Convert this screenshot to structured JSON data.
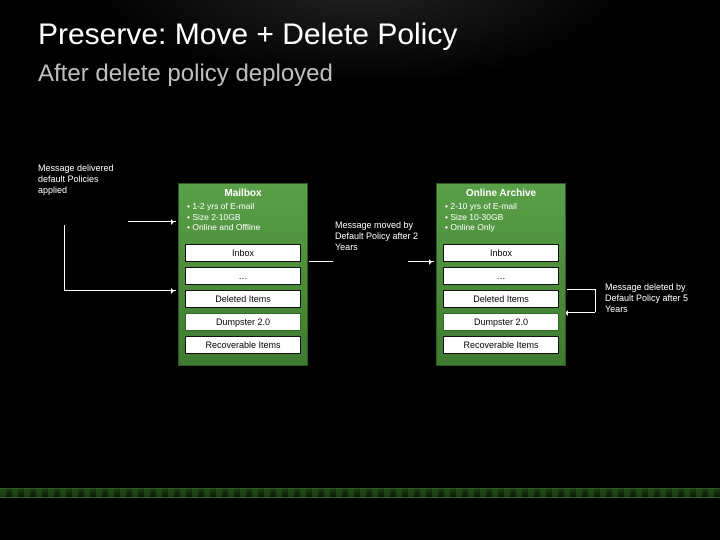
{
  "title": "Preserve: Move + Delete Policy",
  "subtitle": "After delete policy deployed",
  "annotLeft": "Message delivered default Policies applied",
  "annotMid": "Message moved by Default Policy after 2 Years",
  "annotRight": "Message deleted by Default Policy after 5 Years",
  "mailbox": {
    "title": "Mailbox",
    "bullets": "• 1-2 yrs of E-mail\n• Size 2-10GB\n• Online and Offline",
    "rows": [
      "Inbox",
      "…",
      "Deleted Items",
      "Dumpster 2.0",
      "Recoverable Items"
    ]
  },
  "archive": {
    "title": "Online Archive",
    "bullets": "• 2-10 yrs of E-mail\n• Size 10-30GB\n• Online Only",
    "rows": [
      "Inbox",
      "…",
      "Deleted Items",
      "Dumpster 2.0",
      "Recoverable Items"
    ]
  }
}
